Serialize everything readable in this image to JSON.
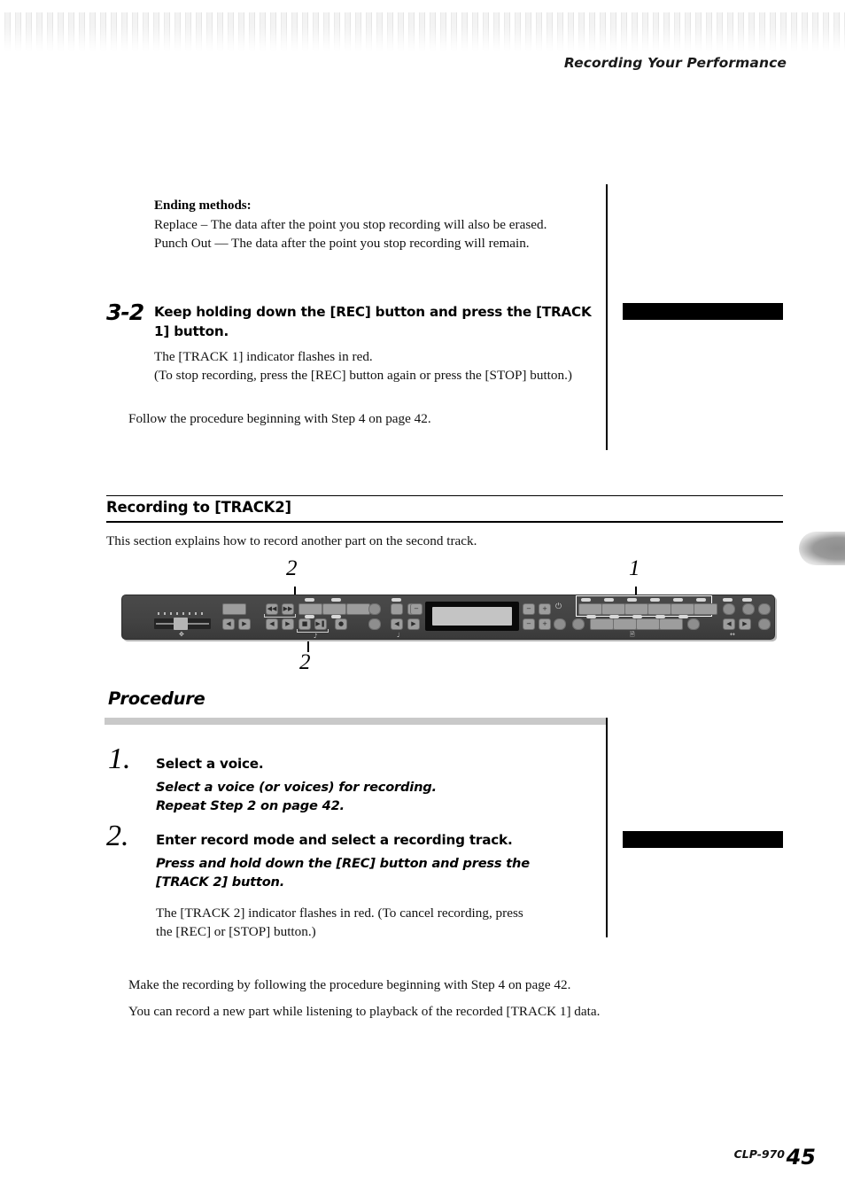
{
  "header": {
    "title": "Recording Your Performance"
  },
  "ending_methods": {
    "title": "Ending methods:",
    "line1": "Replace – The data after the point you stop recording will also be erased.",
    "line2": "Punch Out — The data after the point you stop recording will remain."
  },
  "step_3_2": {
    "number": "3-2",
    "heading": "Keep holding down the [REC] button and press the [TRACK 1] button.",
    "sub1": "The [TRACK 1] indicator flashes in red.",
    "sub2": "(To stop recording, press the [REC] button again or press the [STOP] button.)",
    "follow": "Follow the procedure beginning with Step 4 on page 42."
  },
  "section": {
    "title": "Recording to [TRACK2]",
    "description": "This section explains how to record another part on the second track."
  },
  "panel_diagram": {
    "callout_top_left": "2",
    "callout_top_right": "1",
    "callout_bottom": "2"
  },
  "procedure": {
    "title": "Procedure",
    "steps": [
      {
        "number": "1.",
        "heading": "Select a voice.",
        "sub1": "Select a voice (or voices) for recording.",
        "sub2": "Repeat Step 2 on page 42."
      },
      {
        "number": "2.",
        "heading": "Enter record mode and select a recording track.",
        "sub1": "Press and hold down the [REC] button and press the",
        "sub2": "[TRACK 2] button.",
        "note1": "The [TRACK 2] indicator flashes in red. (To cancel recording, press",
        "note2": "the [REC] or [STOP] button.)"
      }
    ]
  },
  "closing": {
    "line1": "Make the recording by following the procedure beginning with Step 4 on page 42.",
    "line2": "You can record a new part while listening to playback of the recorded [TRACK 1] data."
  },
  "footer": {
    "model": "CLP-970",
    "page": "45"
  },
  "colors": {
    "redaction": "#000000",
    "gray_bar": "#c9c9c9",
    "panel_body": "#434343",
    "panel_button": "#9d9d9d",
    "lcd": "#c4c4c4"
  }
}
